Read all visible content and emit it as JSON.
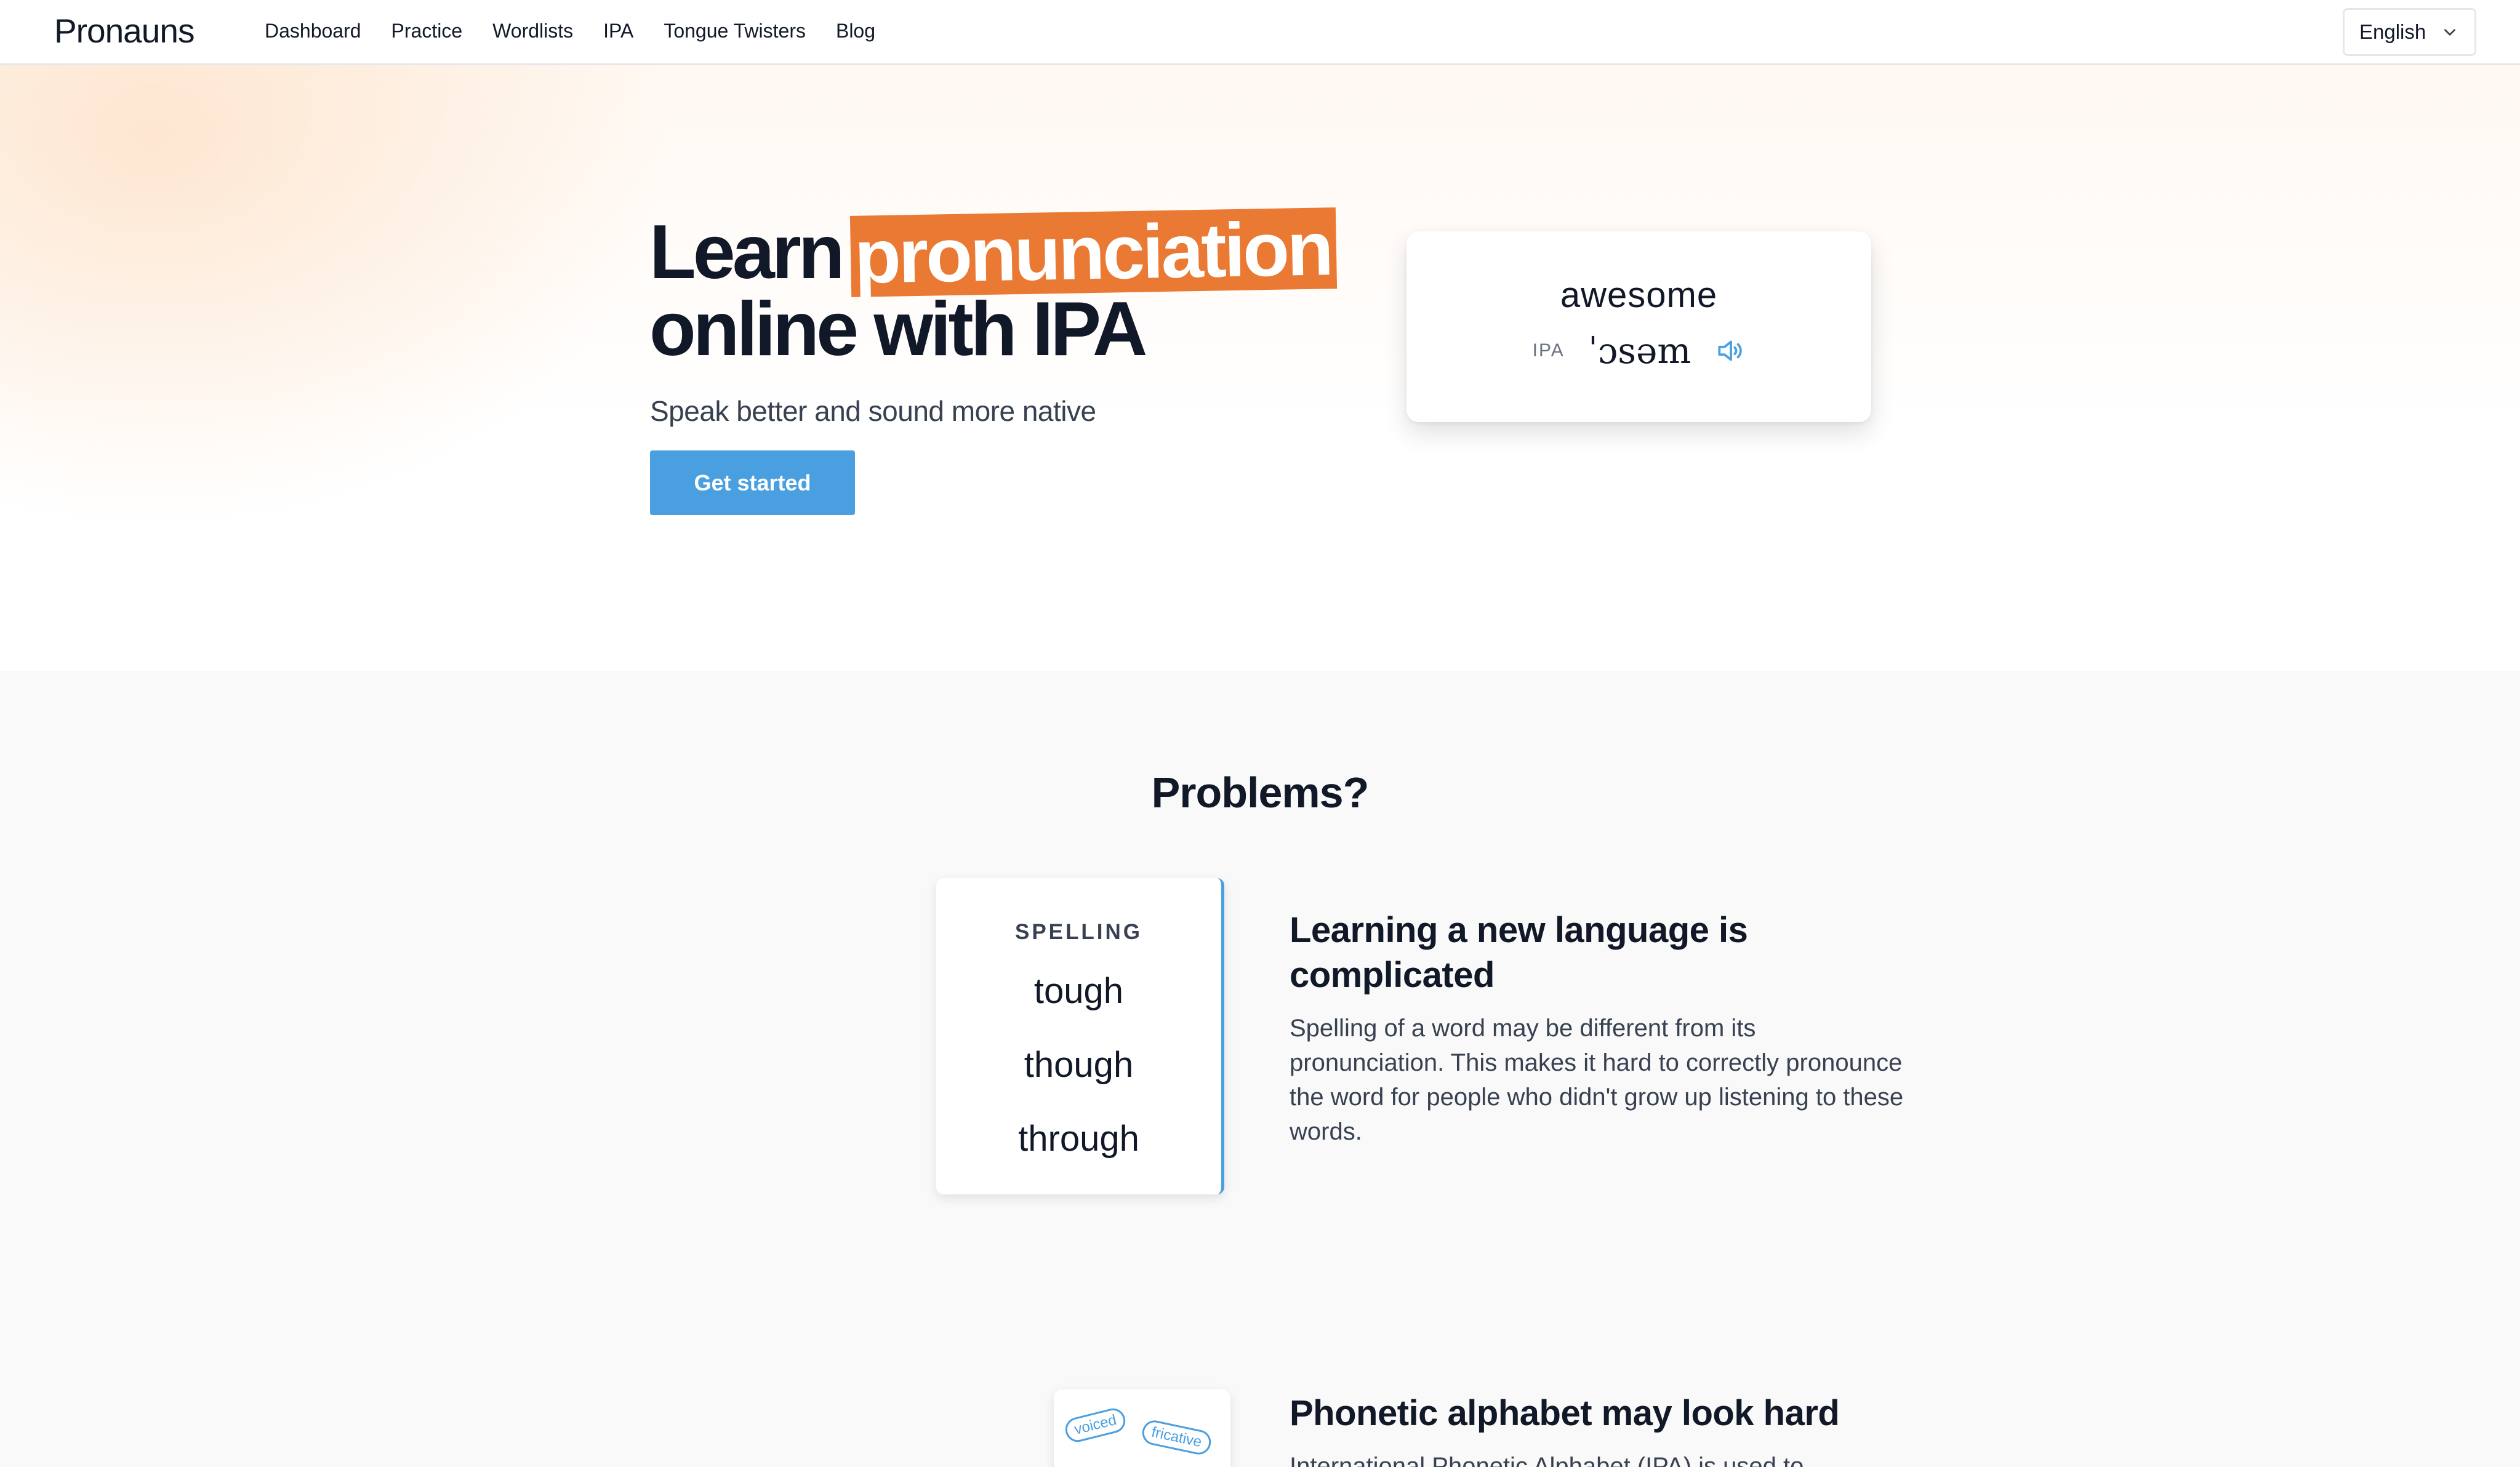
{
  "header": {
    "logo": "Pronauns",
    "nav": [
      "Dashboard",
      "Practice",
      "Wordlists",
      "IPA",
      "Tongue Twisters",
      "Blog"
    ],
    "language": "English"
  },
  "hero": {
    "title_start": "Learn",
    "title_highlight": "pronunciation",
    "title_line2": "online with IPA",
    "subtitle": "Speak better and sound more native",
    "cta": "Get started",
    "highlight_color": "#ea7a33",
    "cta_color": "#4a9fe0",
    "card": {
      "word": "awesome",
      "ipa_label": "IPA",
      "ipa": "ˈɔsəm",
      "audio_icon": "speaker-icon"
    }
  },
  "problems": {
    "title": "Problems?",
    "spelling_card": {
      "label": "SPELLING",
      "words": [
        "tough",
        "though",
        "through"
      ]
    },
    "feature1": {
      "title": "Learning a new language is complicated",
      "body": "Spelling of a word may be different from its pronunciation. This makes it hard to correctly pronounce the word for people who didn't grow up listening to these words."
    },
    "ipa_card": {
      "tags": [
        "voiced",
        "fricative"
      ]
    },
    "feature2": {
      "title": "Phonetic alphabet may look hard",
      "body": "International Phonetic Alphabet (IPA) is used to"
    }
  }
}
